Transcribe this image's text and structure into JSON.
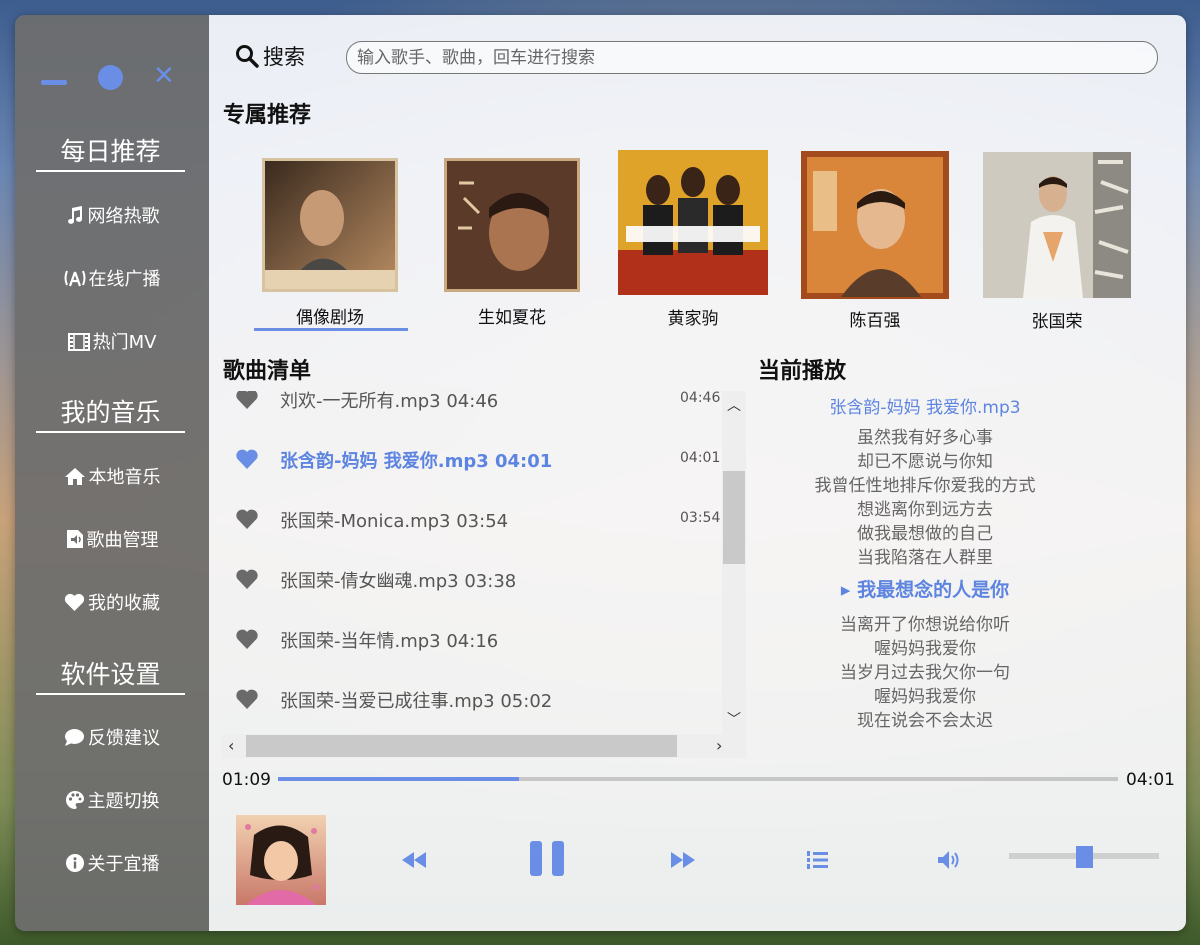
{
  "window_controls": {
    "minimize": "minimize",
    "maximize": "maximize",
    "close": "✕"
  },
  "sidebar": {
    "sections": [
      {
        "title": "每日推荐",
        "items": [
          {
            "label": "网络热歌",
            "icon": "music-note-icon"
          },
          {
            "label": "在线广播",
            "icon": "broadcast-icon"
          },
          {
            "label": "热门MV",
            "icon": "film-icon"
          }
        ]
      },
      {
        "title": "我的音乐",
        "items": [
          {
            "label": "本地音乐",
            "icon": "home-icon"
          },
          {
            "label": "歌曲管理",
            "icon": "audio-file-icon"
          },
          {
            "label": "我的收藏",
            "icon": "heart-icon"
          }
        ]
      },
      {
        "title": "软件设置",
        "items": [
          {
            "label": "反馈建议",
            "icon": "comment-icon"
          },
          {
            "label": "主题切换",
            "icon": "palette-icon"
          },
          {
            "label": "关于宜播",
            "icon": "info-icon"
          }
        ]
      }
    ]
  },
  "search": {
    "label": "搜索",
    "placeholder": "输入歌手、歌曲，回车进行搜索"
  },
  "recommend": {
    "title": "专属推荐",
    "albums": [
      {
        "name": "偶像剧场",
        "selected": true,
        "color": "#7b5a3a"
      },
      {
        "name": "生如夏花",
        "selected": false,
        "color": "#5b3a2a"
      },
      {
        "name": "黄家驹",
        "selected": false,
        "color": "#d89a22"
      },
      {
        "name": "陈百强",
        "selected": false,
        "color": "#c0703a"
      },
      {
        "name": "张国荣",
        "selected": false,
        "color": "#b9b3a8"
      }
    ]
  },
  "playlist": {
    "title": "歌曲清单",
    "songs": [
      {
        "title": "刘欢-一无所有.mp3  04:46",
        "duration": "04:46",
        "active": false
      },
      {
        "title": "张含韵-妈妈 我爱你.mp3  04:01",
        "duration": "04:01",
        "active": true
      },
      {
        "title": "张国荣-Monica.mp3  03:54",
        "duration": "03:54",
        "active": false
      },
      {
        "title": "张国荣-倩女幽魂.mp3  03:38",
        "duration": "",
        "active": false
      },
      {
        "title": "张国荣-当年情.mp3  04:16",
        "duration": "",
        "active": false
      },
      {
        "title": "张国荣-当爱已成往事.mp3  05:02",
        "duration": "",
        "active": false
      }
    ]
  },
  "now_playing": {
    "title": "当前播放",
    "song": "张含韵-妈妈 我爱你.mp3",
    "lyrics": [
      "虽然我有好多心事",
      "却已不愿说与你知",
      "我曾任性地排斥你爱我的方式",
      "想逃离你到远方去",
      "做我最想做的自己",
      "当我陷落在人群里",
      "▸ 我最想念的人是你",
      "当离开了你想说给你听",
      "喔妈妈我爱你",
      "当岁月过去我欠你一句",
      "喔妈妈我爱你",
      "现在说会不会太迟"
    ],
    "current_index": 6
  },
  "player": {
    "elapsed": "01:09",
    "total": "04:01",
    "progress": 0.287,
    "volume": 0.5,
    "accent": "#6a8ee6"
  }
}
